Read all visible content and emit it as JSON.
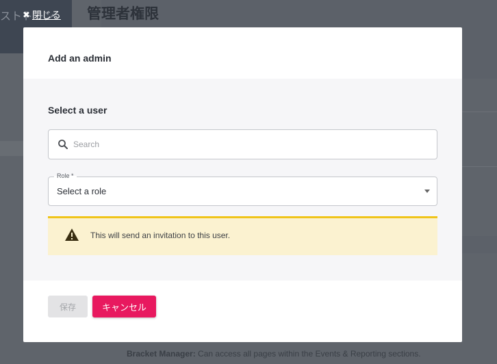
{
  "background": {
    "sidebar_header_text": "ストトーン",
    "page_title": "管理者権限",
    "footnote_bold": "Bracket Manager:",
    "footnote_text": " Can access all pages within the Events & Reporting sections."
  },
  "close_link": {
    "icon": "close-icon",
    "label": "閉じる"
  },
  "modal": {
    "title": "Add an admin",
    "section_title": "Select a user",
    "search": {
      "icon": "search-icon",
      "placeholder": "Search",
      "value": ""
    },
    "role": {
      "label": "Role *",
      "selected": "Select a role",
      "icon": "caret-down-icon"
    },
    "warning": {
      "icon": "warning-icon",
      "text": "This will send an invitation to this user.",
      "accent_color": "#f0c419",
      "background_color": "#fbf2d0"
    },
    "buttons": {
      "save_label": "保存",
      "cancel_label": "キャンセル",
      "cancel_color": "#e8195f"
    }
  }
}
